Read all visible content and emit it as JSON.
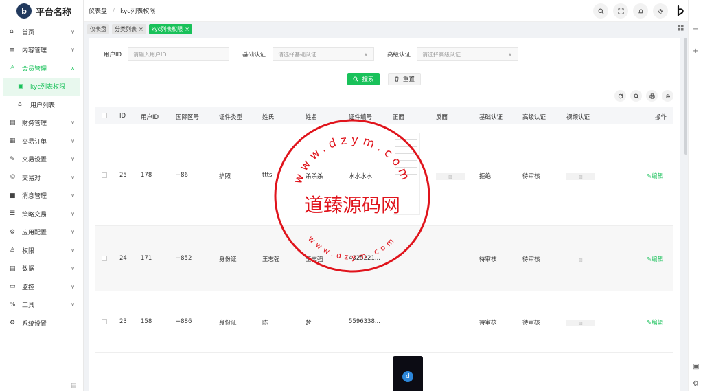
{
  "app": {
    "title": "平台名称",
    "logo_letter": "b"
  },
  "breadcrumb": {
    "home": "仪表盘",
    "sep": "/",
    "current": "kyc列表权限"
  },
  "header_icons": [
    "search-icon",
    "fullscreen-icon",
    "bell-icon",
    "settings-icon"
  ],
  "sidebar": {
    "items": [
      {
        "label": "首页",
        "icon": "⌂"
      },
      {
        "label": "内容管理",
        "icon": "≡"
      },
      {
        "label": "会员管理",
        "icon": "♙"
      },
      {
        "label": "kyc列表权限",
        "icon": "▣"
      },
      {
        "label": "用户列表",
        "icon": "⌂"
      },
      {
        "label": "财务管理",
        "icon": "▤"
      },
      {
        "label": "交易订单",
        "icon": "▦"
      },
      {
        "label": "交易设置",
        "icon": "✎"
      },
      {
        "label": "交易对",
        "icon": "©"
      },
      {
        "label": "消息管理",
        "icon": "■"
      },
      {
        "label": "策略交易",
        "icon": "☰"
      },
      {
        "label": "应用配置",
        "icon": "⚙"
      },
      {
        "label": "权限",
        "icon": "♙"
      },
      {
        "label": "数据",
        "icon": "▤"
      },
      {
        "label": "监控",
        "icon": "▭"
      },
      {
        "label": "工具",
        "icon": "%"
      },
      {
        "label": "系统设置",
        "icon": "⚙"
      }
    ]
  },
  "tabs": [
    {
      "label": "仪表盘"
    },
    {
      "label": "分类列表",
      "close": "×"
    },
    {
      "label": "kyc列表权限",
      "close": "×"
    }
  ],
  "filters": {
    "user_id": {
      "label": "用户ID",
      "placeholder": "请输入用户ID"
    },
    "basic": {
      "label": "基础认证",
      "placeholder": "请选择基础认证"
    },
    "advanced": {
      "label": "高级认证",
      "placeholder": "请选择高级认证"
    }
  },
  "buttons": {
    "search": "搜索",
    "reset": "重置"
  },
  "table": {
    "headers": [
      "ID",
      "用户ID",
      "国际区号",
      "证件类型",
      "姓氏",
      "姓名",
      "证件编号",
      "正面",
      "反面",
      "基础认证",
      "高级认证",
      "视频认证",
      "操作"
    ],
    "rows": [
      {
        "id": "25",
        "user_id": "178",
        "code": "+86",
        "doc_type": "护照",
        "surname": "ttts",
        "name": "杀杀杀",
        "doc_no": "水水水水",
        "basic": "拒绝",
        "advanced": "待审核",
        "action": "编辑"
      },
      {
        "id": "24",
        "user_id": "171",
        "code": "+852",
        "doc_type": "身份证",
        "surname": "王志强",
        "name": "王志强",
        "doc_no": "4325221...",
        "basic": "待审核",
        "advanced": "待审核",
        "action": "编辑"
      },
      {
        "id": "23",
        "user_id": "158",
        "code": "+886",
        "doc_type": "身份证",
        "surname": "陈",
        "name": "梦",
        "doc_no": "5596338...",
        "basic": "待审核",
        "advanced": "待审核",
        "action": "编辑"
      }
    ]
  },
  "watermark": {
    "text": "道臻源码网",
    "url": "www.dzym.com"
  },
  "colors": {
    "accent": "#19c15a",
    "stamp": "#e0141c"
  }
}
